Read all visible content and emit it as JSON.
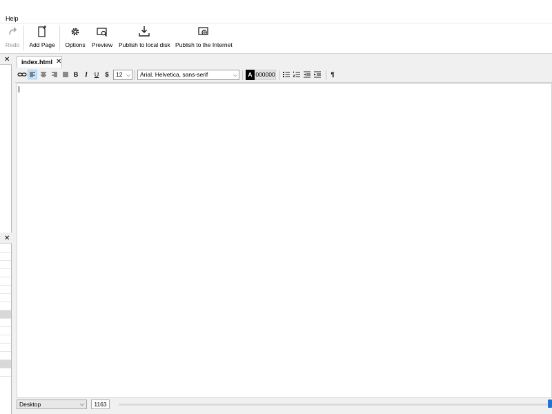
{
  "menu": {
    "help": "Help"
  },
  "ribbon": {
    "redo": "Redo",
    "add_page": "Add Page",
    "options": "Options",
    "preview": "Preview",
    "publish_local": "Publish to local disk",
    "publish_internet": "Publish to the Internet"
  },
  "panels": {
    "close_glyph": "✕"
  },
  "editor": {
    "tab_label": "index.html",
    "tab_close": "✕",
    "format": {
      "bold": "B",
      "italic": "I",
      "underline": "U",
      "strike": "$",
      "font_size": "12",
      "font_family": "Arial, Helvetica, sans-serif",
      "color_letter": "A",
      "color_hex": "000000",
      "pilcrow": "¶"
    }
  },
  "status": {
    "device": "Desktop",
    "width": "1163"
  },
  "colors": {
    "accent": "#1e73d9",
    "selection": "#cce4f7"
  }
}
